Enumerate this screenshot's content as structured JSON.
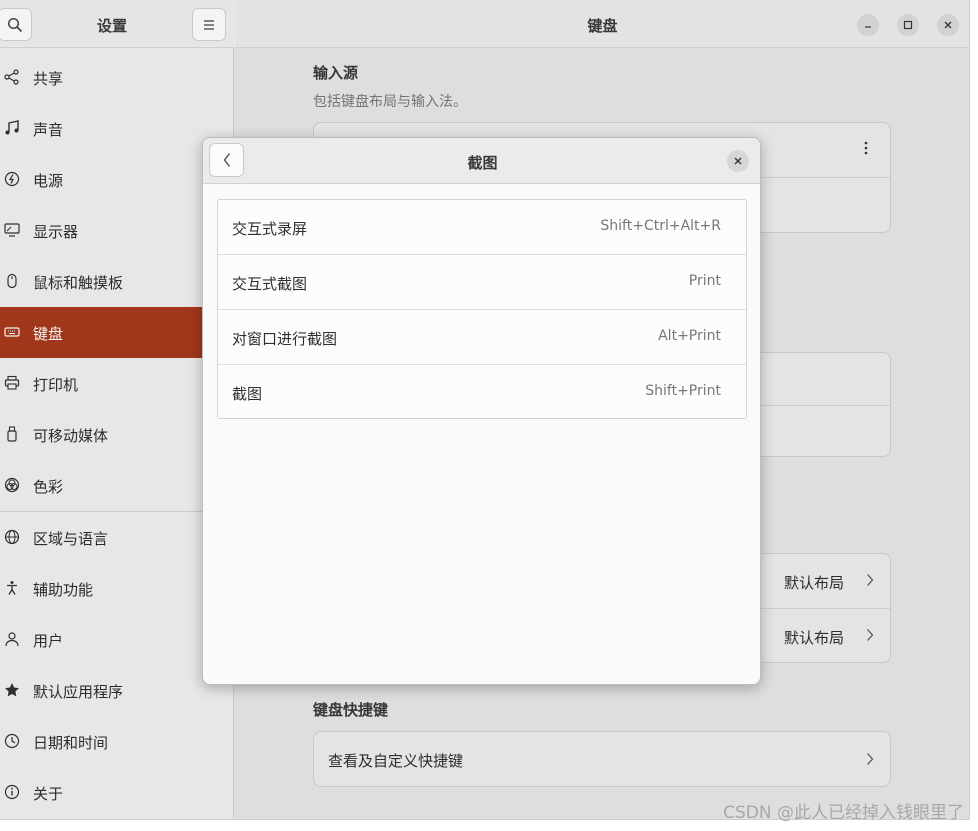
{
  "sidebar": {
    "title": "设置",
    "items": [
      {
        "label": "共享",
        "icon": "share-icon"
      },
      {
        "label": "声音",
        "icon": "music-icon"
      },
      {
        "label": "电源",
        "icon": "power-icon"
      },
      {
        "label": "显示器",
        "icon": "display-icon"
      },
      {
        "label": "鼠标和触摸板",
        "icon": "mouse-icon"
      },
      {
        "label": "键盘",
        "icon": "keyboard-icon",
        "active": true
      },
      {
        "label": "打印机",
        "icon": "printer-icon"
      },
      {
        "label": "可移动媒体",
        "icon": "usb-icon"
      },
      {
        "label": "色彩",
        "icon": "color-icon"
      },
      {
        "label": "区域与语言",
        "icon": "globe-icon"
      },
      {
        "label": "辅助功能",
        "icon": "accessibility-icon"
      },
      {
        "label": "用户",
        "icon": "user-icon"
      },
      {
        "label": "默认应用程序",
        "icon": "star-icon"
      },
      {
        "label": "日期和时间",
        "icon": "clock-icon"
      },
      {
        "label": "关于",
        "icon": "info-icon"
      }
    ]
  },
  "main": {
    "title": "键盘",
    "input_sources": {
      "title": "输入源",
      "subtitle": "包括键盘布局与输入法。"
    },
    "layout_rows": [
      {
        "value": "默认布局"
      },
      {
        "value": "默认布局"
      }
    ],
    "shortcuts": {
      "title": "键盘快捷键",
      "row_label": "查看及自定义快捷键"
    }
  },
  "dialog": {
    "title": "截图",
    "shortcuts": [
      {
        "name": "交互式录屏",
        "keys": "Shift+Ctrl+Alt+R"
      },
      {
        "name": "交互式截图",
        "keys": "Print"
      },
      {
        "name": "对窗口进行截图",
        "keys": "Alt+Print"
      },
      {
        "name": "截图",
        "keys": "Shift+Print"
      }
    ]
  },
  "watermark": "CSDN @此人已经掉入钱眼里了",
  "colors": {
    "accent": "#a93a1c"
  }
}
